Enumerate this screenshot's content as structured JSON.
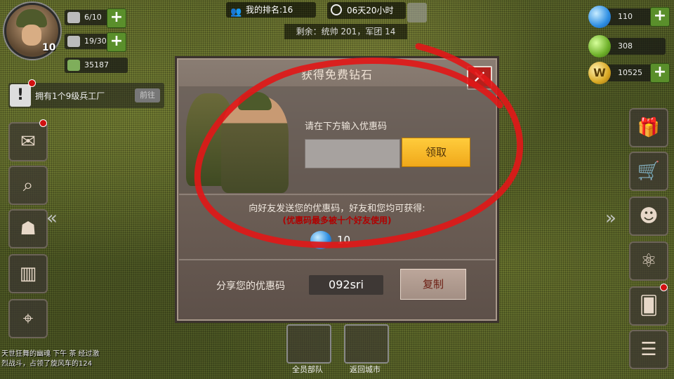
{
  "hud": {
    "level": "10",
    "troops": "6/10",
    "planes": "19/30",
    "money": "35187",
    "quest_text": "拥有1个9级兵工厂",
    "quest_button": "前往"
  },
  "top": {
    "rank": "我的排名:16",
    "timer": "06天20小时",
    "remaining": "剩余：统帅 201，军团 14"
  },
  "currency": {
    "diamonds": "110",
    "oil": "308",
    "gold": "10525"
  },
  "modal": {
    "title": "获得免费钻石",
    "close": "✕",
    "prompt": "请在下方输入优惠码",
    "input_value": "",
    "claim_label": "领取",
    "share_info": "向好友发送您的优惠码，好友和您均可获得:",
    "limit_note": "(优惠码最多被十个好友使用)",
    "reward_value": "10",
    "share_label": "分享您的优惠码",
    "my_code": "092sri",
    "copy_label": "复制"
  },
  "chat": {
    "line1": "天世狂舞的幽魂 下午 茶 经过激",
    "line2": "烈战斗，占领了旋风车的124"
  },
  "bottom": {
    "btn1_label": "全员部队",
    "btn2_label": "返回城市"
  },
  "colors": {
    "annotation": "#e01818",
    "claim_button": "#f6b52a",
    "close_button": "#b3201c",
    "limit_note": "#b00000"
  }
}
